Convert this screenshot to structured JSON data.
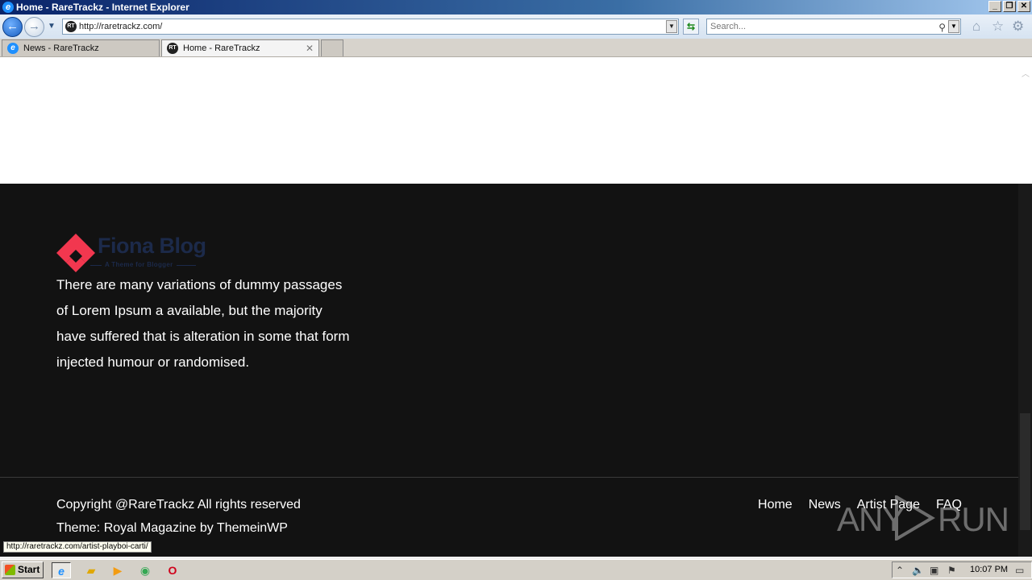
{
  "window": {
    "title": "Home - RareTrackz - Internet Explorer",
    "app_icon": "ie-icon",
    "buttons": {
      "minimize": "_",
      "restore": "❐",
      "close": "✕"
    }
  },
  "address_bar": {
    "url": "http://raretrackz.com/",
    "search_placeholder": "Search...",
    "icons": [
      "back-icon",
      "forward-icon",
      "home-icon",
      "favorites-star-icon",
      "gear-icon"
    ]
  },
  "tabs": [
    {
      "label": "News - RareTrackz",
      "active": false
    },
    {
      "label": "Home - RareTrackz",
      "active": true
    }
  ],
  "footer": {
    "logo_title": "Fiona Blog",
    "logo_subtitle": "A Theme for Blogger",
    "about_text": "There are many variations of dummy passages of Lorem Ipsum a available, but the majority have suffered that is alteration in some that form injected humour or randomised.",
    "copyright": "Copyright @RareTrackz All rights reserved",
    "theme_credit": "Theme: Royal Magazine by ThemeinWP",
    "nav": [
      "Home",
      "News",
      "Artist Page",
      "FAQ"
    ]
  },
  "status_bar": {
    "link_preview": "http://raretrackz.com/artist-playboi-carti/"
  },
  "watermark": {
    "text_left": "ANY",
    "text_right": "RUN"
  },
  "taskbar": {
    "start_label": "Start",
    "apps": [
      "ie-icon",
      "explorer-folder-icon",
      "media-player-icon",
      "chrome-icon",
      "opera-icon"
    ],
    "clock": "10:07 PM"
  },
  "colors": {
    "footer_bg": "#121212",
    "logo_red": "#f2374f",
    "logo_navy": "#1c2a4a"
  }
}
